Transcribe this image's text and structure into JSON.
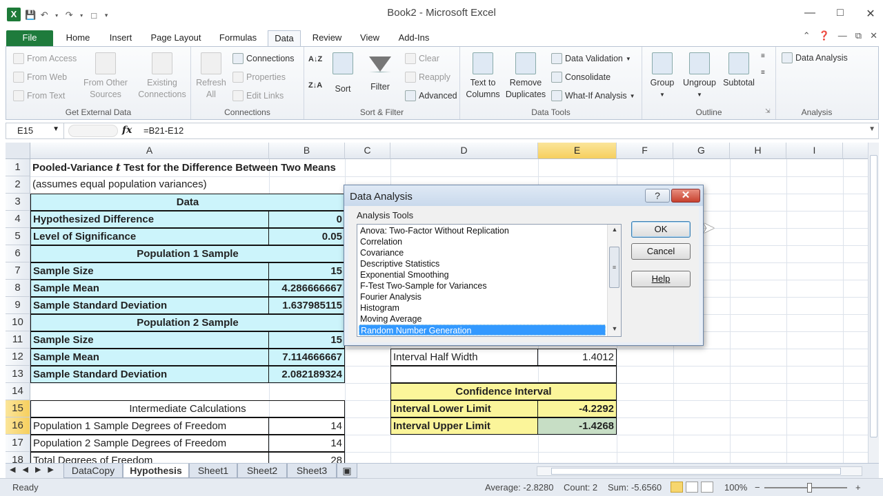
{
  "app": {
    "title": "Book2  -  Microsoft Excel",
    "logo": "X",
    "qat": [
      "save-icon",
      "undo-icon",
      "redo-icon",
      "new-icon",
      "customize-icon"
    ]
  },
  "tabs": [
    "File",
    "Home",
    "Insert",
    "Page Layout",
    "Formulas",
    "Data",
    "Review",
    "View",
    "Add-Ins"
  ],
  "active_tab": "Data",
  "ribbon": {
    "get_external": {
      "label": "Get External Data",
      "from_access": "From Access",
      "from_web": "From Web",
      "from_text": "From Text",
      "from_other_1": "From Other",
      "from_other_2": "Sources",
      "existing_1": "Existing",
      "existing_2": "Connections"
    },
    "connections": {
      "label": "Connections",
      "refresh_1": "Refresh",
      "refresh_2": "All",
      "connections": "Connections",
      "properties": "Properties",
      "edit_links": "Edit Links"
    },
    "sort_filter": {
      "label": "Sort & Filter",
      "sort": "Sort",
      "filter": "Filter",
      "clear": "Clear",
      "reapply": "Reapply",
      "advanced": "Advanced"
    },
    "data_tools": {
      "label": "Data Tools",
      "text_to_1": "Text to",
      "text_to_2": "Columns",
      "remove_1": "Remove",
      "remove_2": "Duplicates",
      "validation": "Data Validation",
      "consolidate": "Consolidate",
      "whatif": "What-If Analysis"
    },
    "outline": {
      "label": "Outline",
      "group": "Group",
      "ungroup": "Ungroup",
      "subtotal": "Subtotal"
    },
    "analysis": {
      "label": "Analysis",
      "data_analysis": "Data Analysis"
    }
  },
  "formula_bar": {
    "name_box": "E15",
    "fx": "fx",
    "formula": "=B21-E12"
  },
  "columns": [
    "A",
    "B",
    "C",
    "D",
    "E",
    "F",
    "G",
    "H",
    "I"
  ],
  "selected_column": "E",
  "rows": [
    "1",
    "2",
    "3",
    "4",
    "5",
    "6",
    "7",
    "8",
    "9",
    "10",
    "11",
    "12",
    "13",
    "14",
    "15",
    "16",
    "17",
    "18"
  ],
  "selected_rows": [
    "15",
    "16"
  ],
  "cells": {
    "a1_pre": "Pooled-Variance ",
    "a1_t": "t",
    "a1_post": "  Test for the Difference Between Two Means",
    "a2": "(assumes equal population variances)",
    "a3": "Data",
    "a4": "Hypothesized Difference",
    "b4": "0",
    "a5": "Level of Significance",
    "b5": "0.05",
    "a6": "Population 1 Sample",
    "a7": "Sample Size",
    "b7": "15",
    "a8": "Sample Mean",
    "b8": "4.286666667",
    "a9": "Sample Standard Deviation",
    "b9": "1.637985115",
    "a10": "Population 2 Sample",
    "a11": "Sample Size",
    "b11": "15",
    "a12": "Sample Mean",
    "b12": "7.114666667",
    "a13": "Sample Standard Deviation",
    "b13": "2.082189324",
    "a15": "Intermediate Calculations",
    "a16": "Population 1 Sample Degrees of Freedom",
    "b16": "14",
    "a17": "Population 2 Sample Degrees of Freedom",
    "b17": "14",
    "a18": "Total Degrees of Freedom",
    "b18": "28",
    "d12": "Interval Half Width",
    "e12": "1.4012",
    "d14": "Confidence Interval",
    "d15": "Interval Lower Limit",
    "e15": "-4.2292",
    "d16": "Interval Upper Limit",
    "e16": "-1.4268"
  },
  "sheets": [
    "DataCopy",
    "Hypothesis",
    "Sheet1",
    "Sheet2",
    "Sheet3"
  ],
  "active_sheet": "Hypothesis",
  "status": {
    "ready": "Ready",
    "average": "Average: -2.8280",
    "count": "Count: 2",
    "sum": "Sum: -5.6560",
    "zoom": "100%",
    "minus": "−",
    "plus": "+"
  },
  "dialog": {
    "title": "Data Analysis",
    "help_glyph": "?",
    "close_glyph": "✕",
    "tools_label": "Analysis Tools",
    "items": [
      "Anova: Two-Factor Without Replication",
      "Correlation",
      "Covariance",
      "Descriptive Statistics",
      "Exponential Smoothing",
      "F-Test Two-Sample for Variances",
      "Fourier Analysis",
      "Histogram",
      "Moving Average",
      "Random Number Generation"
    ],
    "selected": "Random Number Generation",
    "ok": "OK",
    "cancel": "Cancel",
    "help": "Help"
  }
}
